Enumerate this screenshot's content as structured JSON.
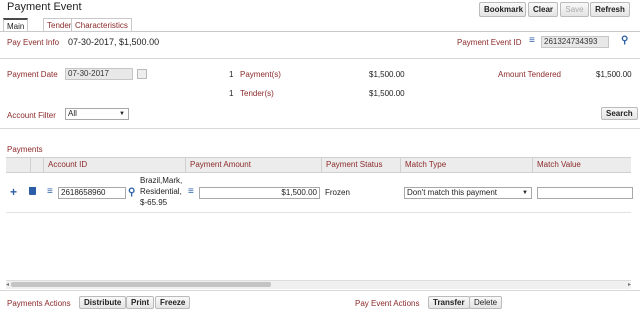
{
  "page": {
    "title": "Payment Event"
  },
  "toolbar": {
    "bookmark": "Bookmark",
    "clear": "Clear",
    "save": "Save",
    "refresh": "Refresh"
  },
  "tabs": [
    "Main",
    "Tenders",
    "Characteristics"
  ],
  "info": {
    "label": "Pay Event Info",
    "value": "07-30-2017, $1,500.00",
    "event_id_label": "Payment Event ID",
    "event_id": "261324734393"
  },
  "summary": {
    "date_label": "Payment Date",
    "date_value": "07-30-2017",
    "payments_count": "1",
    "payments_label": "Payment(s)",
    "payments_amount": "$1,500.00",
    "tendered_label": "Amount Tendered",
    "tendered_amount": "$1,500.00",
    "tenders_count": "1",
    "tenders_label": "Tender(s)",
    "tenders_amount": "$1,500.00"
  },
  "filter": {
    "label": "Account Filter",
    "value": "All",
    "search": "Search"
  },
  "payments": {
    "section_label": "Payments",
    "columns": [
      "Account ID",
      "Payment Amount",
      "Payment Status",
      "Match Type",
      "Match Value"
    ],
    "rows": [
      {
        "account_id": "2618658960",
        "account_desc": [
          "Brazil,Mark,",
          "Residential,",
          "$-65.95"
        ],
        "amount": "$1,500.00",
        "status": "Frozen",
        "match_type": "Don't match this payment",
        "match_value": ""
      }
    ]
  },
  "actions": {
    "payments_label": "Payments Actions",
    "distribute": "Distribute",
    "print": "Print",
    "freeze": "Freeze",
    "event_label": "Pay Event Actions",
    "transfer": "Transfer",
    "delete": "Delete"
  },
  "colors": {
    "label": "#8c2a2a",
    "icon": "#2b5ea7"
  }
}
